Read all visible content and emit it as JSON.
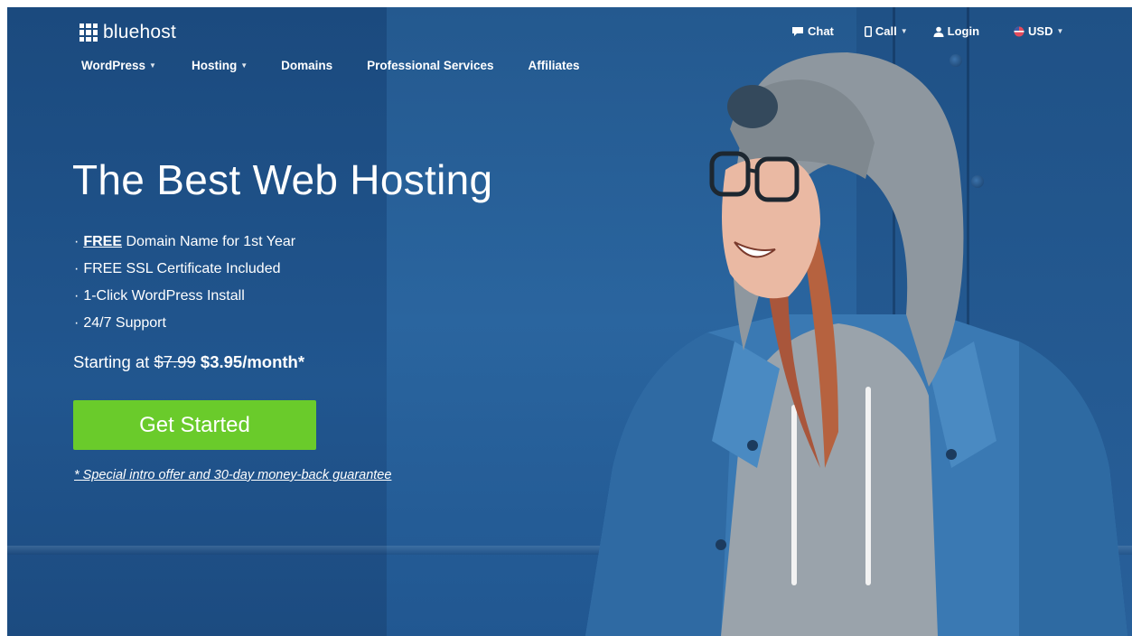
{
  "brand": {
    "name": "bluehost",
    "icon": "grid-logo-icon"
  },
  "nav": {
    "main": [
      {
        "label": "WordPress",
        "has_dropdown": true
      },
      {
        "label": "Hosting",
        "has_dropdown": true
      },
      {
        "label": "Domains",
        "has_dropdown": false
      },
      {
        "label": "Professional Services",
        "has_dropdown": false
      },
      {
        "label": "Affiliates",
        "has_dropdown": false
      }
    ],
    "utility": [
      {
        "label": "Chat",
        "icon": "chat-bubble-icon",
        "has_dropdown": false
      },
      {
        "label": "Call",
        "icon": "phone-icon",
        "has_dropdown": true
      },
      {
        "label": "Login",
        "icon": "user-icon",
        "has_dropdown": false
      },
      {
        "label": "USD",
        "icon": "us-flag-icon",
        "has_dropdown": true
      }
    ]
  },
  "hero": {
    "title": "The Best Web Hosting",
    "features": [
      {
        "prefix": "·",
        "highlight": "FREE",
        "text": " Domain Name for 1st Year"
      },
      {
        "prefix": "·",
        "highlight": "",
        "text": "FREE SSL Certificate Included"
      },
      {
        "prefix": "·",
        "highlight": "",
        "text": "1-Click WordPress Install"
      },
      {
        "prefix": "·",
        "highlight": "",
        "text": "24/7 Support"
      }
    ],
    "pricing": {
      "lead": "Starting at ",
      "old_price": "$7.99",
      "new_price": "$3.95/month*"
    },
    "cta_label": "Get Started",
    "guarantee": "* Special intro offer and 30-day money-back guarantee"
  },
  "colors": {
    "background": "#21568f",
    "cta": "#6acb2b",
    "text": "#ffffff"
  }
}
